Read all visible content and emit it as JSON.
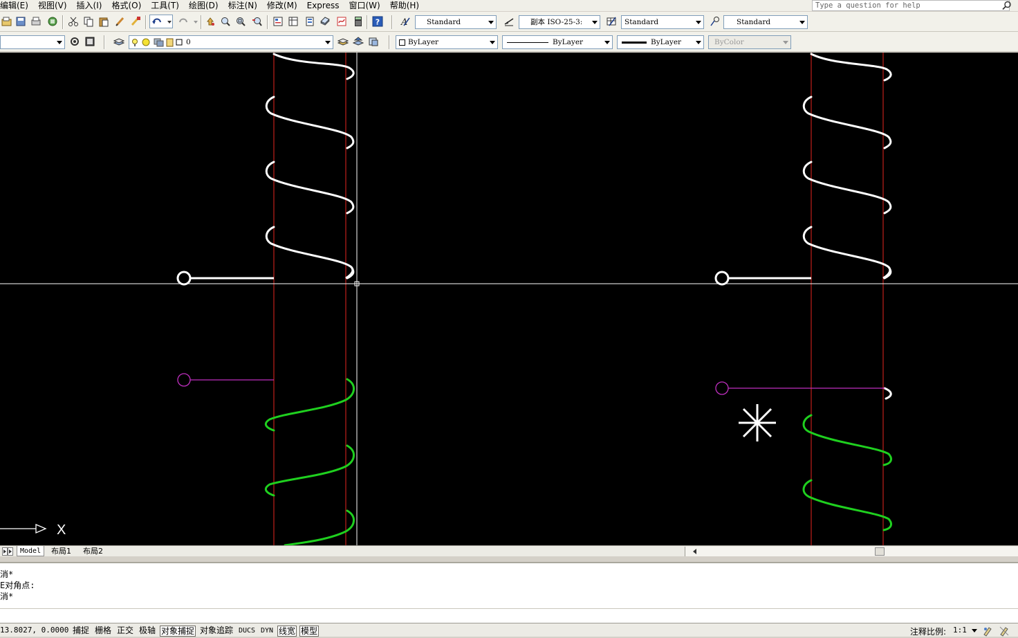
{
  "menu": {
    "items": [
      "编辑(E)",
      "视图(V)",
      "插入(I)",
      "格式(O)",
      "工具(T)",
      "绘图(D)",
      "标注(N)",
      "修改(M)",
      "Express",
      "窗口(W)",
      "帮助(H)"
    ]
  },
  "help": {
    "placeholder": "Type a question for help"
  },
  "toolbar_styles": {
    "text_style": "Standard",
    "dim_style": "副本 ISO-25-3:",
    "table_style": "Standard",
    "multileader_style": "Standard"
  },
  "layers": {
    "current_layer": "0"
  },
  "properties": {
    "color": "ByLayer",
    "linetype": "ByLayer",
    "lineweight": "ByLayer",
    "plotstyle": "ByColor"
  },
  "drawing": {
    "background": "#000000",
    "ucs_x_label": "X",
    "colors": {
      "spring_white": "#ffffff",
      "spring_green": "#1fd01f",
      "guide_red": "#c0201a",
      "lead_magenta": "#c02fc0",
      "crosshair": "#ffffff"
    }
  },
  "tabs": {
    "items": [
      "Model",
      "布局1",
      "布局2"
    ],
    "active": "Model"
  },
  "command_history": [
    "消*",
    "E对角点:",
    "消*"
  ],
  "status": {
    "coordinates": "13.8027, 0.0000",
    "toggles": [
      {
        "label": "捕捉",
        "on": false
      },
      {
        "label": "栅格",
        "on": false
      },
      {
        "label": "正交",
        "on": false
      },
      {
        "label": "极轴",
        "on": false
      },
      {
        "label": "对象捕捉",
        "on": true
      },
      {
        "label": "对象追踪",
        "on": false
      },
      {
        "label": "DUCS",
        "on": false
      },
      {
        "label": "DYN",
        "on": false
      },
      {
        "label": "线宽",
        "on": true
      },
      {
        "label": "模型",
        "on": true
      }
    ],
    "annotation_scale_label": "注释比例:",
    "annotation_scale_value": "1:1"
  }
}
